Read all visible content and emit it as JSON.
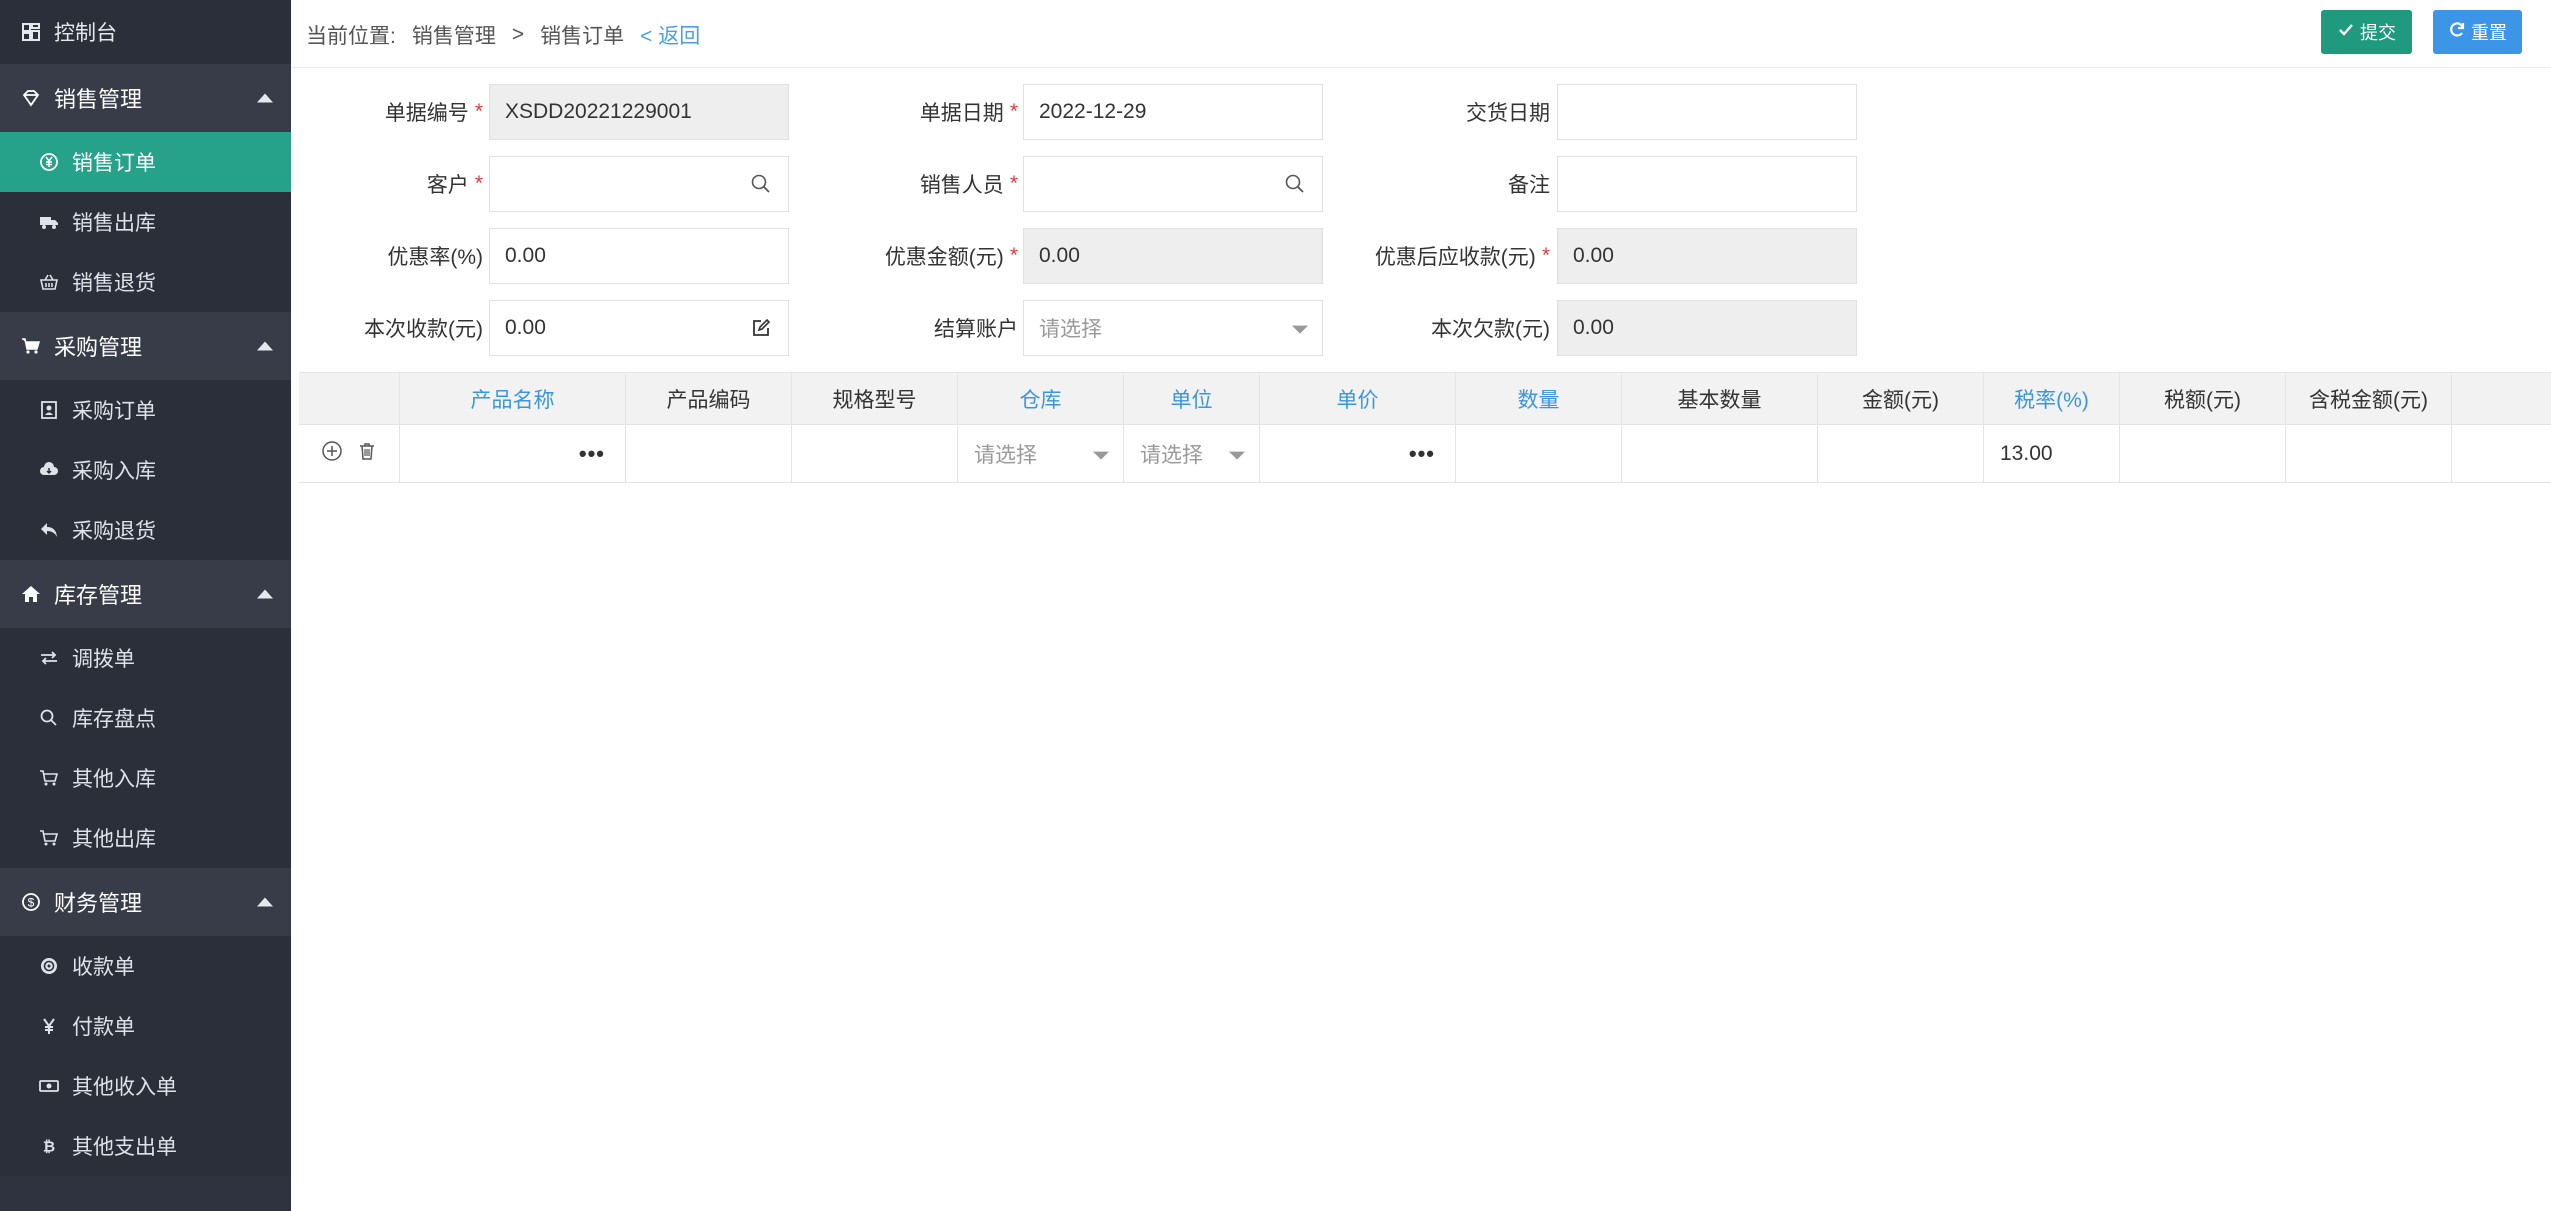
{
  "sidebar": {
    "dashboard": "控制台",
    "groups": [
      {
        "label": "销售管理",
        "icon": "diamond-icon",
        "items": [
          {
            "label": "销售订单",
            "icon": "yen-circle-icon"
          },
          {
            "label": "销售出库",
            "icon": "truck-icon"
          },
          {
            "label": "销售退货",
            "icon": "basket-icon"
          }
        ]
      },
      {
        "label": "采购管理",
        "icon": "cart-icon",
        "items": [
          {
            "label": "采购订单",
            "icon": "id-card-icon"
          },
          {
            "label": "采购入库",
            "icon": "cloud-download-icon"
          },
          {
            "label": "采购退货",
            "icon": "reply-icon"
          }
        ]
      },
      {
        "label": "库存管理",
        "icon": "home-icon",
        "items": [
          {
            "label": "调拨单",
            "icon": "exchange-icon"
          },
          {
            "label": "库存盘点",
            "icon": "search-icon"
          },
          {
            "label": "其他入库",
            "icon": "cart-outline-icon"
          },
          {
            "label": "其他出库",
            "icon": "cart-outline-icon"
          }
        ]
      },
      {
        "label": "财务管理",
        "icon": "dollar-circle-icon",
        "items": [
          {
            "label": "收款单",
            "icon": "target-icon"
          },
          {
            "label": "付款单",
            "icon": "yen-icon"
          },
          {
            "label": "其他收入单",
            "icon": "money-icon"
          },
          {
            "label": "其他支出单",
            "icon": "bitcoin-icon"
          }
        ]
      }
    ]
  },
  "breadcrumb": {
    "prefix": "当前位置:",
    "level1": "销售管理",
    "sep": ">",
    "level2": "销售订单",
    "back": "< 返回"
  },
  "toolbar": {
    "submit_label": "提交",
    "reset_label": "重置"
  },
  "form": {
    "doc_no": {
      "label": "单据编号",
      "value": "XSDD20221229001"
    },
    "doc_date": {
      "label": "单据日期",
      "value": "2022-12-29"
    },
    "delivery_date": {
      "label": "交货日期",
      "value": ""
    },
    "customer": {
      "label": "客户",
      "value": ""
    },
    "salesperson": {
      "label": "销售人员",
      "value": ""
    },
    "remark": {
      "label": "备注",
      "value": ""
    },
    "discount_rate": {
      "label": "优惠率(%)",
      "value": "0.00"
    },
    "discount_amount": {
      "label": "优惠金额(元)",
      "value": "0.00"
    },
    "receivable_after": {
      "label": "优惠后应收款(元)",
      "value": "0.00"
    },
    "received_now": {
      "label": "本次收款(元)",
      "value": "0.00"
    },
    "account": {
      "label": "结算账户",
      "placeholder": "请选择"
    },
    "debt_now": {
      "label": "本次欠款(元)",
      "value": "0.00"
    }
  },
  "grid": {
    "headers": [
      "产品名称",
      "产品编码",
      "规格型号",
      "仓库",
      "单位",
      "单价",
      "数量",
      "基本数量",
      "金额(元)",
      "税率(%)",
      "税额(元)",
      "含税金额(元)"
    ],
    "row": {
      "warehouse_placeholder": "请选择",
      "unit_placeholder": "请选择",
      "tax_rate": "13.00"
    }
  }
}
